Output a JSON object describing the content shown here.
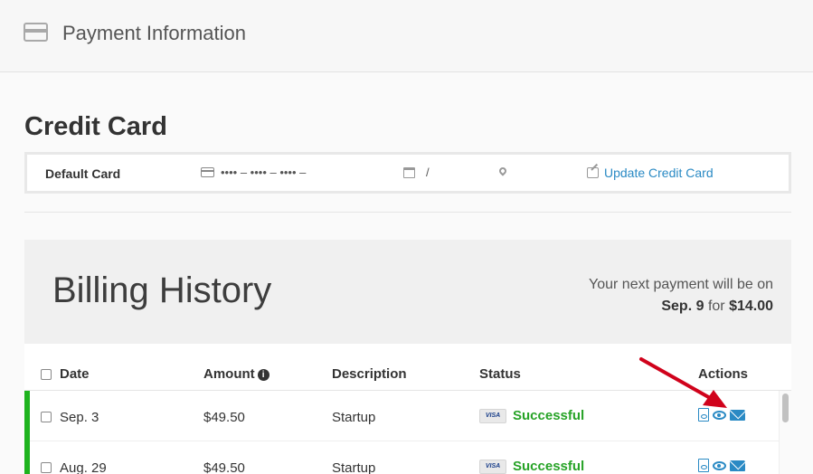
{
  "header": {
    "title": "Payment Information",
    "icon": "credit-card-icon"
  },
  "credit_card": {
    "heading": "Credit Card",
    "default_label": "Default Card",
    "card_number": "•••• – •••• – •••• –",
    "expiry": "/",
    "update_label": "Update Credit Card"
  },
  "billing": {
    "title": "Billing History",
    "next_payment_prefix": "Your next payment will be on",
    "next_date": "Sep. 9",
    "for_word": "for",
    "next_amount": "$14.00"
  },
  "table": {
    "columns": {
      "date": "Date",
      "amount": "Amount",
      "description": "Description",
      "status": "Status",
      "actions": "Actions"
    },
    "rows": [
      {
        "date": "Sep. 3",
        "amount": "$49.50",
        "description": "Startup",
        "card": "VISA",
        "status": "Successful"
      },
      {
        "date": "Aug. 29",
        "amount": "$49.50",
        "description": "Startup",
        "card": "VISA",
        "status": "Successful"
      }
    ]
  },
  "colors": {
    "accent": "#2a8ac4",
    "success": "#27a327",
    "status_bar": "#1eb31e",
    "annotation_arrow": "#d0021b"
  }
}
